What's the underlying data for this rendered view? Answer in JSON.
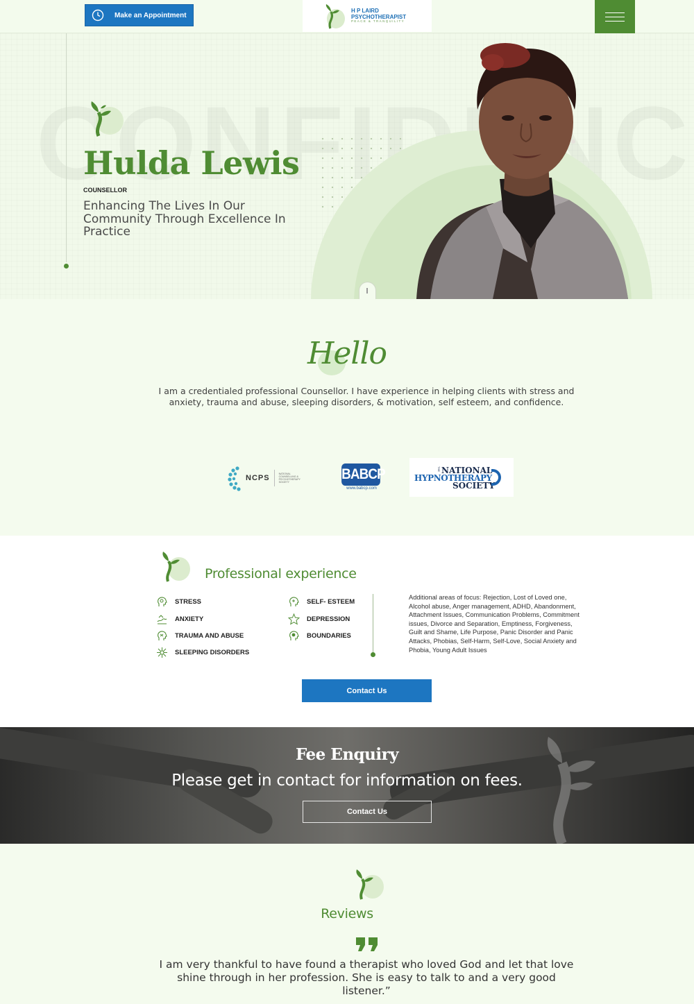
{
  "header": {
    "appointment_label": "Make an Appointment",
    "logo": {
      "line1": "H P LAIRD",
      "line2": "PSYCHOTHERAPIST",
      "line3": "PEACE & TRANQUILITY"
    }
  },
  "hero": {
    "background_word": "CONFIDENCE",
    "name": "Hulda Lewis",
    "role": "COUNSELLOR",
    "tagline": "Enhancing The Lives In Our Community Through Excellence In Practice"
  },
  "hello": {
    "title": "Hello",
    "text": "I am a credentialed professional Counsellor. I have experience in helping clients with stress and anxiety, trauma and abuse, sleeping disorders, & motivation, self esteem, and confidence."
  },
  "logos": {
    "ncps": {
      "name": "NCPS",
      "subtitle": "NATIONAL COUNSELLING & PSYCHOTHERAPY SOCIETY"
    },
    "babcp": {
      "name": "BABCP",
      "url": "www.babcp.com"
    },
    "nhs": {
      "the": "THE",
      "line1": "NATIONAL",
      "line2": "HYPNOTHERAPY",
      "line3": "SOCIETY"
    }
  },
  "experience": {
    "title": "Professional experience",
    "items_left": [
      "STRESS",
      "ANXIETY",
      "TRAUMA AND ABUSE",
      "SLEEPING DISORDERS"
    ],
    "items_right": [
      "SELF- ESTEEM",
      "DEPRESSION",
      "BOUNDARIES"
    ],
    "additional": "Additional areas of focus: Rejection, Lost of Loved one, Alcohol abuse, Anger management, ADHD, Abandonment, Attachment Issues, Communication Problems, Commitment issues, Divorce and Separation, Emptiness, Forgiveness, Guilt and Shame, Life Purpose, Panic Disorder and Panic Attacks, Phobias, Self-Harm, Self-Love, Social Anxiety and Phobia, Young Adult Issues",
    "contact_label": "Contact Us"
  },
  "fee": {
    "title": "Fee Enquiry",
    "subtitle": "Please get in contact for information on fees.",
    "contact_label": "Contact Us"
  },
  "reviews": {
    "title": "Reviews",
    "quote": "I am very thankful to have found a therapist who loved God and let that love shine through in her profession. She is easy to talk to and a very good listener.”"
  },
  "colors": {
    "brand_green": "#4f8c33",
    "brand_blue": "#1d76c1",
    "page_bg": "#f4fbee"
  }
}
